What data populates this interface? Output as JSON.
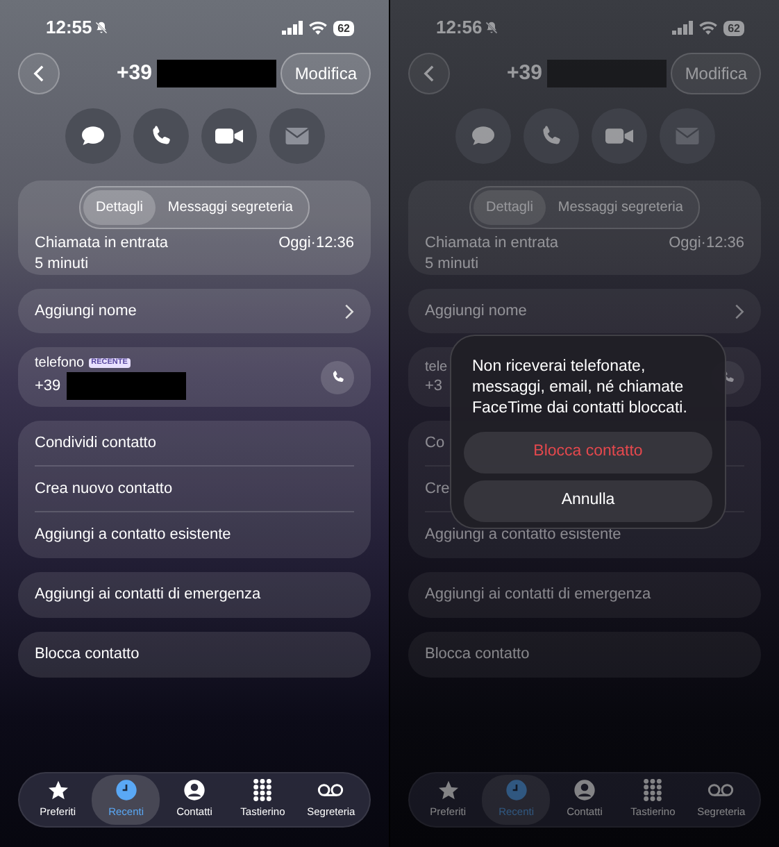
{
  "screens": [
    {
      "dimmed": false,
      "status": {
        "time": "12:55",
        "battery": "62"
      },
      "header": {
        "prefix": "+39",
        "redacted": true,
        "edit": "Modifica"
      },
      "call_card": {
        "tabs": [
          {
            "label": "Dettagli",
            "selected": true
          },
          {
            "label": "Messaggi segreteria",
            "selected": false
          }
        ],
        "type": "Chiamata in entrata",
        "date": "Oggi·12:36",
        "duration": "5 minuti"
      },
      "name_row": "Aggiungi nome",
      "phone": {
        "label": "telefono",
        "badge": "RECENTE",
        "prefix": "+39",
        "redacted": true
      },
      "groups": [
        [
          "Condividi contatto",
          "Crea nuovo contatto",
          "Aggiungi a contatto esistente"
        ],
        [
          "Aggiungi ai contatti di emergenza"
        ],
        [
          "Blocca contatto"
        ]
      ],
      "tab_bar": [
        {
          "label": "Preferiti",
          "kind": "star",
          "selected": false
        },
        {
          "label": "Recenti",
          "kind": "clock",
          "selected": true
        },
        {
          "label": "Contatti",
          "kind": "person",
          "selected": false
        },
        {
          "label": "Tastierino",
          "kind": "keypad",
          "selected": false
        },
        {
          "label": "Segreteria",
          "kind": "voicemail",
          "selected": false
        }
      ]
    },
    {
      "dimmed": true,
      "status": {
        "time": "12:56",
        "battery": "62"
      },
      "header": {
        "prefix": "+39",
        "redacted": true,
        "edit": "Modifica"
      },
      "call_card": {
        "tabs": [
          {
            "label": "Dettagli",
            "selected": true
          },
          {
            "label": "Messaggi segreteria",
            "selected": false
          }
        ],
        "type": "Chiamata in entrata",
        "date": "Oggi·12:36",
        "duration": "5 minuti"
      },
      "name_row": "Aggiungi nome",
      "phone": {
        "label": "tele",
        "prefix": "+3",
        "redacted": false
      },
      "groups": [
        [
          "Co",
          "Cre",
          "Aggiungi a contatto esistente"
        ],
        [
          "Aggiungi ai contatti di emergenza"
        ],
        [
          "Blocca contatto"
        ]
      ],
      "tab_bar": [
        {
          "label": "Preferiti",
          "kind": "star",
          "selected": false
        },
        {
          "label": "Recenti",
          "kind": "clock",
          "selected": true
        },
        {
          "label": "Contatti",
          "kind": "person",
          "selected": false
        },
        {
          "label": "Tastierino",
          "kind": "keypad",
          "selected": false
        },
        {
          "label": "Segreteria",
          "kind": "voicemail",
          "selected": false
        }
      ],
      "dialog": {
        "message": "Non riceverai telefonate, messaggi, email, né chiamate FaceTime dai contatti bloccati.",
        "buttons": [
          {
            "label": "Blocca contatto",
            "kind": "destructive"
          },
          {
            "label": "Annulla",
            "kind": "cancel"
          }
        ]
      }
    }
  ]
}
